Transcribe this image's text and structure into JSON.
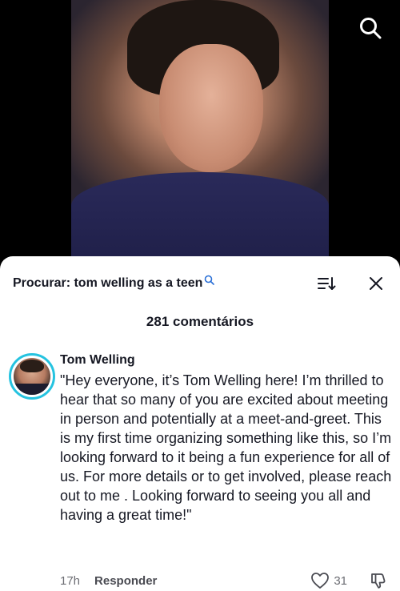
{
  "video": {
    "search_icon": "search-icon"
  },
  "comments_panel": {
    "search_label": "Procurar: tom welling as a teen",
    "search_icon": "search-small-icon",
    "sort_icon": "sort-icon",
    "close_icon": "close-icon",
    "count_label": "281 comentários"
  },
  "comment": {
    "author": "Tom Welling",
    "text": "\"Hey everyone, it’s Tom Welling here! I’m thrilled to hear that so many of you are excited about meeting in person and potentially at a meet-and-greet. This is my first time organizing something like this, so I’m looking forward to it being a fun experience for all of us. For more details or to get involved, please reach out to me . Looking forward to seeing you all and having a great time!\"",
    "time": "17h",
    "reply_label": "Responder",
    "like_count": "31",
    "like_icon": "heart-icon",
    "dislike_icon": "thumbs-down-icon",
    "avatar_ring_color": "#25c3e0"
  }
}
